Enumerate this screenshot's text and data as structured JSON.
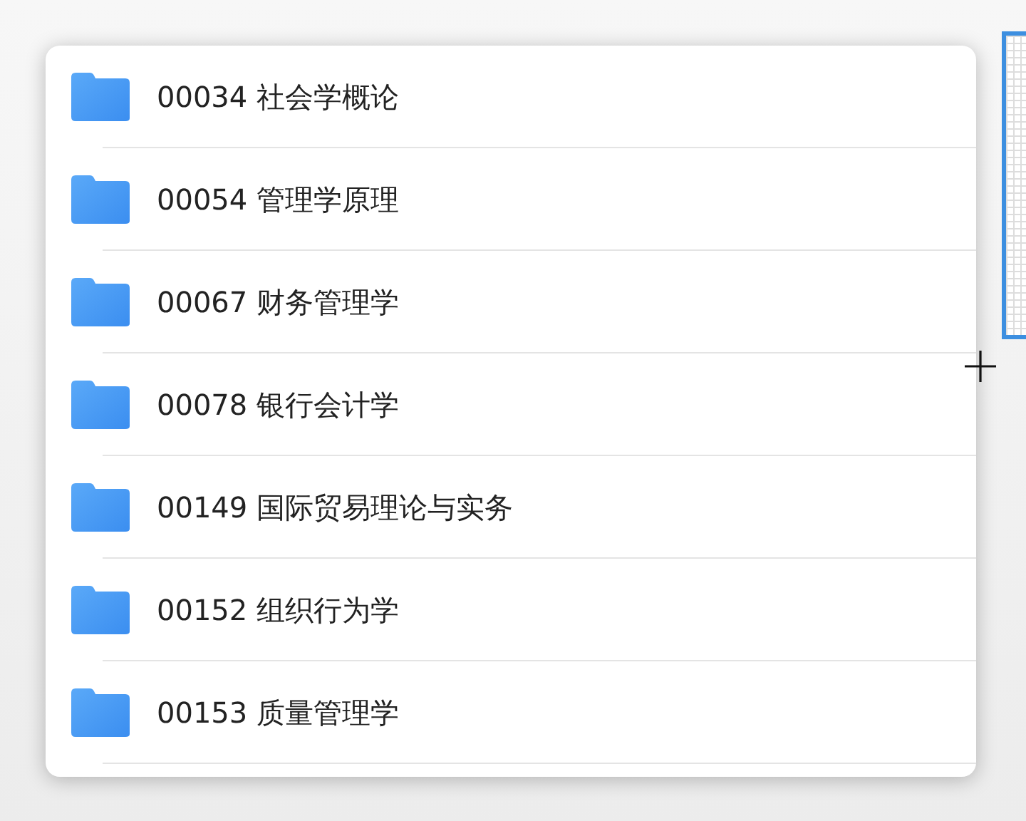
{
  "folders": [
    {
      "name": "00034 社会学概论"
    },
    {
      "name": "00054 管理学原理"
    },
    {
      "name": "00067 财务管理学"
    },
    {
      "name": "00078 银行会计学"
    },
    {
      "name": "00149 国际贸易理论与实务"
    },
    {
      "name": "00152 组织行为学"
    },
    {
      "name": "00153 质量管理学"
    }
  ]
}
